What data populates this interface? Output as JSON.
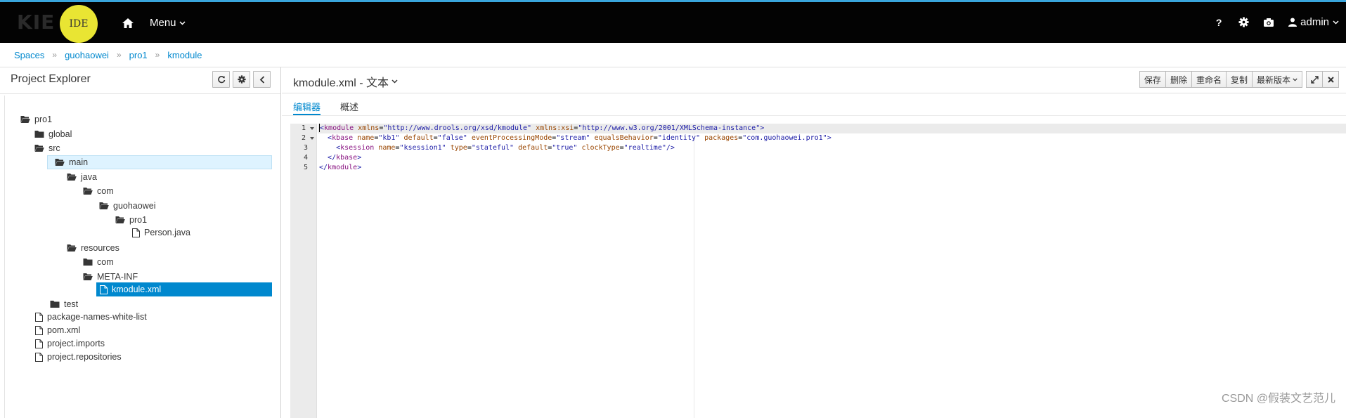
{
  "header": {
    "logo_text": "KIE",
    "logo_badge": "IDE",
    "menu_label": "Menu",
    "help_label": "?",
    "user_label": "admin"
  },
  "breadcrumb": [
    "Spaces",
    "guohaowei",
    "pro1",
    "kmodule"
  ],
  "explorer": {
    "title": "Project Explorer",
    "tree": [
      {
        "label": "pro1",
        "type": "folder-open"
      },
      {
        "label": "global",
        "type": "folder"
      },
      {
        "label": "src",
        "type": "folder-open"
      },
      {
        "label": "main",
        "type": "folder-open"
      },
      {
        "label": "java",
        "type": "folder-open"
      },
      {
        "label": "com",
        "type": "folder-open"
      },
      {
        "label": "guohaowei",
        "type": "folder-open"
      },
      {
        "label": "pro1",
        "type": "folder-open"
      },
      {
        "label": "Person.java",
        "type": "file"
      },
      {
        "label": "resources",
        "type": "folder-open"
      },
      {
        "label": "com",
        "type": "folder"
      },
      {
        "label": "META-INF",
        "type": "folder-open"
      },
      {
        "label": "kmodule.xml",
        "type": "file"
      },
      {
        "label": "test",
        "type": "folder"
      },
      {
        "label": "package-names-white-list",
        "type": "file"
      },
      {
        "label": "pom.xml",
        "type": "file"
      },
      {
        "label": "project.imports",
        "type": "file"
      },
      {
        "label": "project.repositories",
        "type": "file"
      }
    ]
  },
  "editor_panel": {
    "title": "kmodule.xml - 文本",
    "toolbar": {
      "save": "保存",
      "delete": "删除",
      "rename": "重命名",
      "copy": "复制",
      "latest_version": "最新版本"
    },
    "tabs": [
      "编辑器",
      "概述"
    ],
    "line_numbers": [
      "1",
      "2",
      "3",
      "4",
      "5"
    ],
    "code": {
      "l1": {
        "open": "kmodule",
        "a1": "xmlns",
        "v1": "\"http://www.drools.org/xsd/kmodule\"",
        "a2": "xmlns:xsi",
        "v2": "\"http://www.w3.org/2001/XMLSchema-instance\""
      },
      "l2": {
        "open": "kbase",
        "a1": "name",
        "v1": "\"kb1\"",
        "a2": "default",
        "v2": "\"false\"",
        "a3": "eventProcessingMode",
        "v3": "\"stream\"",
        "a4": "equalsBehavior",
        "v4": "\"identity\"",
        "a5": "packages",
        "v5": "\"com.guohaowei.pro1\""
      },
      "l3": {
        "open": "ksession",
        "a1": "name",
        "v1": "\"ksession1\"",
        "a2": "type",
        "v2": "\"stateful\"",
        "a3": "default",
        "v3": "\"true\"",
        "a4": "clockType",
        "v4": "\"realtime\""
      },
      "l4": {
        "close": "kbase"
      },
      "l5": {
        "close": "kmodule"
      }
    }
  },
  "watermark": "CSDN @假装文艺范儿",
  "colors": {
    "accent": "#0088ce",
    "topbar": "#030303",
    "topbar_border": "#39a5dc",
    "selected_row": "#0088ce",
    "highlight_row": "#def3ff"
  }
}
